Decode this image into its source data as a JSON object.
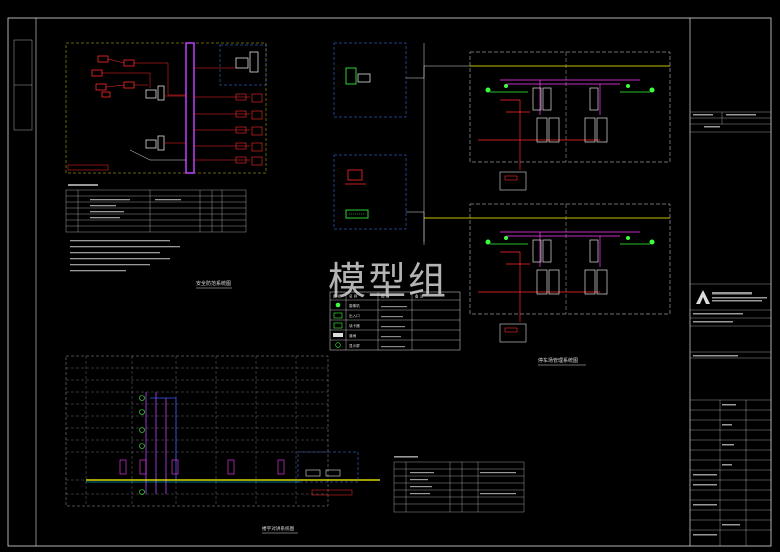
{
  "watermark": "模型组",
  "titles": {
    "security_system": "安全防范系统图",
    "parking_system": "停车场管理系统图",
    "intercom_system": "楼宇对讲系统图",
    "table_left": "设备材料表",
    "table_center": "主要设备表",
    "table_bottom": "设备材料表"
  },
  "legend_headers": [
    "图 例",
    "名 称",
    "规 格",
    "备 注"
  ],
  "legend_rows": [
    {
      "name": "摄像机",
      "icon": "camera-icon"
    },
    {
      "name": "出入口",
      "icon": "gate-icon"
    },
    {
      "name": "读卡器",
      "icon": "card-reader-icon"
    },
    {
      "name": "道闸",
      "icon": "barrier-icon"
    },
    {
      "name": "显示屏",
      "icon": "display-icon"
    }
  ],
  "title_block": {
    "company": "建筑设计研究院有限公司",
    "project": "项目名称",
    "drawing": "弱电系统图",
    "scale": "1:100"
  },
  "colors": {
    "background": "#000000",
    "frame": "#ffffff",
    "red": "#ff2a2a",
    "magenta": "#ff3cff",
    "green": "#3cff3c",
    "yellow": "#ffff00",
    "cyan": "#00e5ff",
    "blue": "#3c5aff",
    "dashed_box": "#4a7fff"
  }
}
